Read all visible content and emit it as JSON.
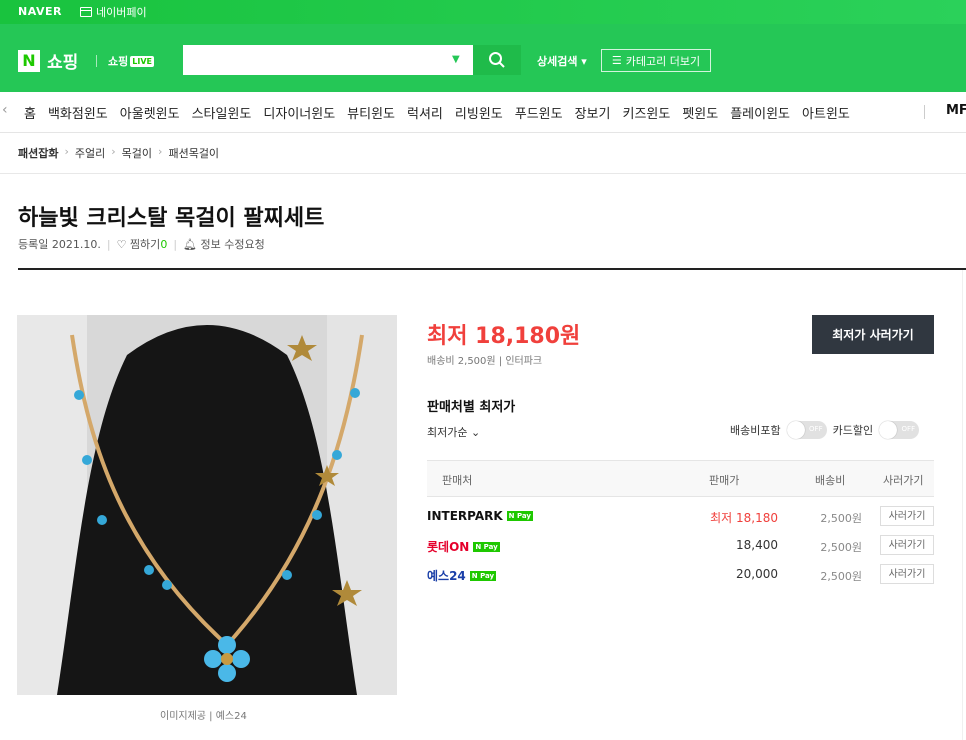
{
  "topbar": {
    "logo": "NAVER",
    "npay": "네이버페이"
  },
  "header": {
    "n_logo": "N",
    "shopping": "쇼핑",
    "shopping_live": "쇼핑",
    "live_badge": "LIVE",
    "search_placeholder": "",
    "detail_search": "상세검색 ▾",
    "category_more": "카테고리 더보기"
  },
  "nav": {
    "items": [
      "홈",
      "백화점윈도",
      "아울렛윈도",
      "스타일윈도",
      "디자이너윈도",
      "뷰티윈도",
      "럭셔리",
      "리빙윈도",
      "푸드윈도",
      "장보기",
      "키즈윈도",
      "펫윈도",
      "플레이윈도",
      "아트윈도"
    ],
    "extra": "MF"
  },
  "breadcrumb": [
    "패션잡화",
    "주얼리",
    "목걸이",
    "패션목걸이"
  ],
  "product": {
    "title": "하늘빛 크리스탈 목걸이 팔찌세트",
    "registered": "등록일 2021.10.",
    "wish_label": "찜하기",
    "wish_count": "0",
    "edit_request": "정보 수정요청",
    "image_credit": "이미지제공 | 예스24"
  },
  "pricing": {
    "lowest_label": "최저 18,180원",
    "shipping": "배송비 2,500원 | 인터파크",
    "buy_lowest": "최저가 사러가기",
    "section_title": "판매처별 최저가",
    "sort": "최저가순 ⌄",
    "toggle_shipping": "배송비포함",
    "toggle_card": "카드할인",
    "toggle_off": "OFF"
  },
  "table": {
    "headers": [
      "판매처",
      "판매가",
      "배송비",
      "사러가기"
    ],
    "rows": [
      {
        "seller": "INTERPARK",
        "price": "최저 18,180",
        "shipping": "2,500원",
        "buy": "사러가기",
        "lowest": true
      },
      {
        "seller": "롯데ON",
        "price": "18,400",
        "shipping": "2,500원",
        "buy": "사러가기",
        "lowest": false
      },
      {
        "seller": "예스24",
        "price": "20,000",
        "shipping": "2,500원",
        "buy": "사러가기",
        "lowest": false
      }
    ],
    "npay": "N Pay"
  },
  "colors": {
    "green": "#25c756",
    "red": "#f0403c",
    "dark": "#303740"
  }
}
